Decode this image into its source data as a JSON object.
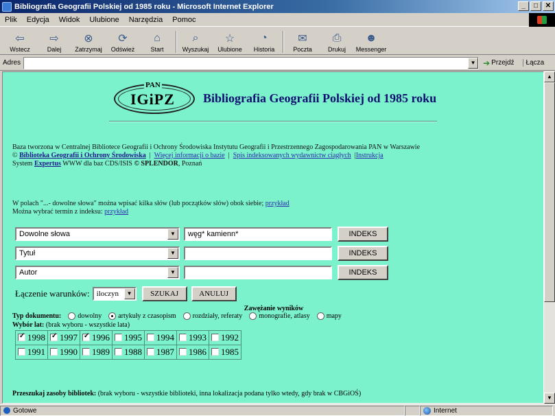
{
  "window": {
    "title": "Bibliografia Geografii Polskiej od 1985 roku - Microsoft Internet Explorer",
    "controls": [
      "_",
      "□",
      "✕"
    ]
  },
  "menu": [
    "Plik",
    "Edycja",
    "Widok",
    "Ulubione",
    "Narzędzia",
    "Pomoc"
  ],
  "toolbar": [
    {
      "label": "Wstecz",
      "icon": "back-arrow-icon",
      "glyph": "⇦"
    },
    {
      "label": "Dalej",
      "icon": "forward-arrow-icon",
      "glyph": "⇨"
    },
    {
      "label": "Zatrzymaj",
      "icon": "stop-icon",
      "glyph": "⊗"
    },
    {
      "label": "Odśwież",
      "icon": "refresh-icon",
      "glyph": "⟳"
    },
    {
      "label": "Start",
      "icon": "home-icon",
      "glyph": "⌂"
    },
    {
      "label": "Wyszukaj",
      "icon": "search-icon",
      "glyph": "⌕"
    },
    {
      "label": "Ulubione",
      "icon": "favorites-icon",
      "glyph": "☆"
    },
    {
      "label": "Historia",
      "icon": "history-icon",
      "glyph": "◔"
    },
    {
      "label": "Poczta",
      "icon": "mail-icon",
      "glyph": "✉"
    },
    {
      "label": "Drukuj",
      "icon": "print-icon",
      "glyph": "⎙"
    },
    {
      "label": "Messenger",
      "icon": "messenger-icon",
      "glyph": "☻"
    }
  ],
  "address": {
    "label": "Adres",
    "value": "",
    "go": "Przejdź",
    "links": "Łącza"
  },
  "page": {
    "logo_top": "PAN",
    "logo_main": "IGiPZ",
    "title": "Bibliografia Geografii Polskiej od 1985 roku",
    "intro_line1": "Baza tworzona w Centralnej Bibliotece Geografii i Ochrony Środowiska Instytutu Geografii i Przestrzennego Zagospodarowania PAN w Warszawie",
    "copyright_sym": "©",
    "link_library": "Biblioteka Geografii i Ochrony Środowiska",
    "link_more": "Więcej informacji o bazie",
    "link_serials": "Spis indeksowanych wydawnictw ciągłych",
    "link_instr": "Instrukcja",
    "system_pre": "System",
    "link_expertus": "Expertus",
    "system_mid": "WWW dla baz CDS/ISIS",
    "system_splendor": "© SPLENDOR",
    "system_post": ", Poznań",
    "hint1_pre": "W polach \"...- dowolne słowa\" można wpisać kilka słów (lub początków słów) obok siebie;",
    "hint1_link": "przykład",
    "hint2_pre": "Można wybrać termin z indeksu:",
    "hint2_link": "przykład"
  },
  "form": {
    "rows": [
      {
        "field": "Dowolne słowa",
        "value": "węg* kamienn*",
        "button": "INDEKS"
      },
      {
        "field": "Tytuł",
        "value": "",
        "button": "INDEKS"
      },
      {
        "field": "Autor",
        "value": "",
        "button": "INDEKS"
      }
    ],
    "join_label": "Łączenie warunków:",
    "join_value": "iloczyn",
    "search": "SZUKAJ",
    "cancel": "ANULUJ"
  },
  "restrict": {
    "title": "Zawężanie wyników",
    "doctype_label": "Typ dokumentu:",
    "doctypes": [
      {
        "label": "dowolny",
        "checked": false
      },
      {
        "label": "artykuły z czasopism",
        "checked": true
      },
      {
        "label": "rozdziały, referaty",
        "checked": false
      },
      {
        "label": "monografie, atlasy",
        "checked": false
      },
      {
        "label": "mapy",
        "checked": false
      }
    ],
    "years_label": "Wybór lat:",
    "years_note": "(brak wyboru - wszystkie lata)",
    "years_row1": [
      {
        "y": "1998",
        "c": true
      },
      {
        "y": "1997",
        "c": true
      },
      {
        "y": "1996",
        "c": true
      },
      {
        "y": "1995",
        "c": false
      },
      {
        "y": "1994",
        "c": false
      },
      {
        "y": "1993",
        "c": false
      },
      {
        "y": "1992",
        "c": false
      }
    ],
    "years_row2": [
      {
        "y": "1991",
        "c": false
      },
      {
        "y": "1990",
        "c": false
      },
      {
        "y": "1989",
        "c": false
      },
      {
        "y": "1988",
        "c": false
      },
      {
        "y": "1987",
        "c": false
      },
      {
        "y": "1986",
        "c": false
      },
      {
        "y": "1985",
        "c": false
      }
    ],
    "libs_label": "Przeszukaj zasoby bibliotek:",
    "libs_note": "(brak wyboru - wszystkie biblioteki, inna lokalizacja podana tylko wtedy, gdy brak w CBGiOŚ)"
  },
  "status": {
    "left": "Gotowe",
    "zone": "Internet"
  },
  "colors": {
    "page_bg": "#7cf2cc",
    "title_text": "#101070",
    "link": "#2a2aaa"
  }
}
